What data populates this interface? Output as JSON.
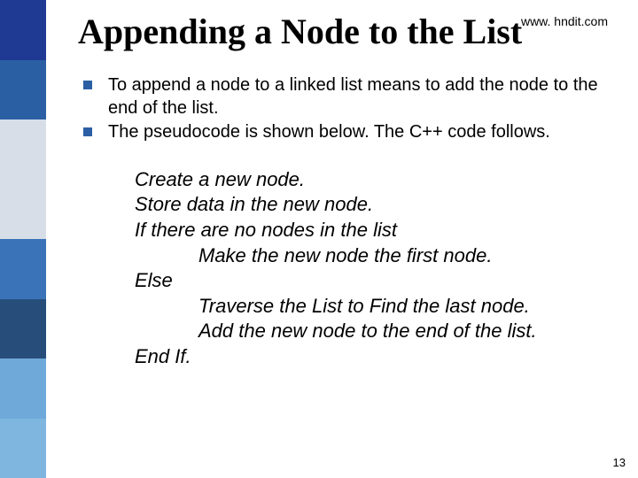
{
  "title": "Appending a Node to the List",
  "watermark": "www. hndit.com",
  "bullets": [
    "To append a node to a linked list means to add the node to the end of the list.",
    "The pseudocode is shown below. The C++ code follows."
  ],
  "pseudo": {
    "l1": "Create a new node.",
    "l2": "Store data in the new node.",
    "l3": "If there are no nodes in the list",
    "l4": "Make the new node the first node.",
    "l5": "Else",
    "l6": "Traverse the List to Find the last node.",
    "l7": "Add the new node to the end of the list.",
    "l8": "End If."
  },
  "page_number": "13"
}
